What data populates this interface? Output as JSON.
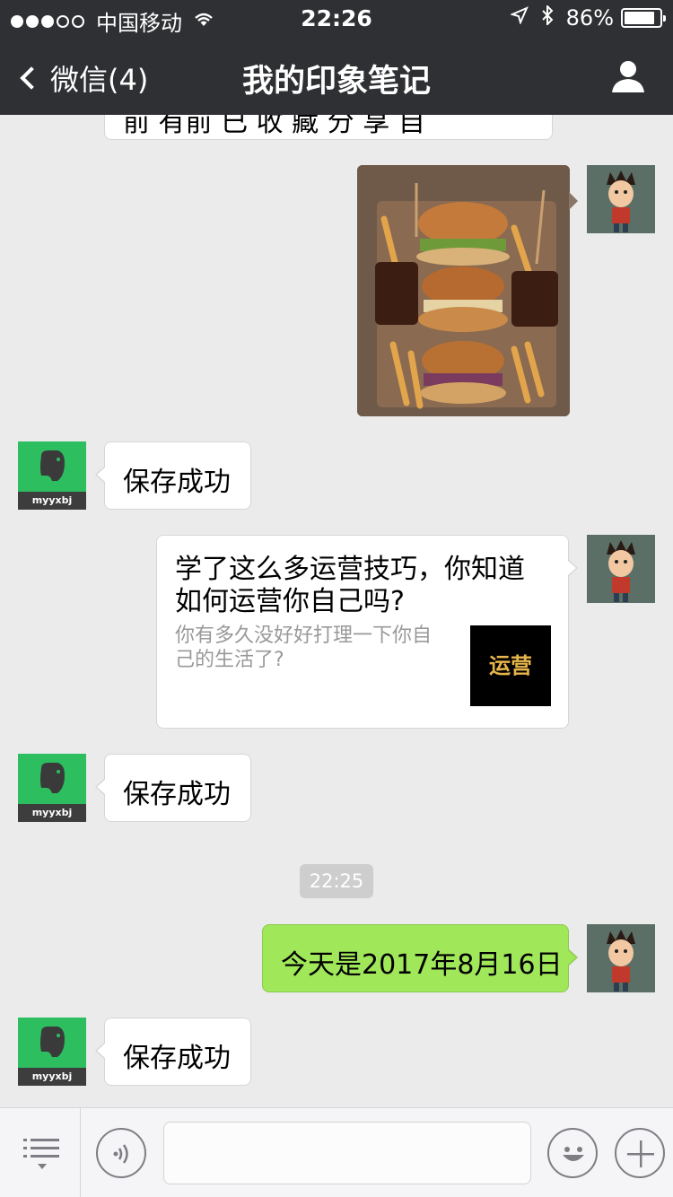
{
  "status_bar": {
    "carrier": "中国移动",
    "time": "22:26",
    "battery_percent": "86%",
    "battery_level": 0.86,
    "signal_bars_filled": 3,
    "signal_bars_total": 5
  },
  "nav": {
    "back_label": "微信(4)",
    "title": "我的印象笔记"
  },
  "messages": {
    "top_cut_text": "前 有前 已 收 藏 分 享 自",
    "saved_1": "保存成功",
    "card_title": "学了这么多运营技巧，你知道如何运营你自己吗?",
    "card_desc": "你有多久没好好打理一下你自己的生活了?",
    "card_thumb_text": "运营",
    "saved_2": "保存成功",
    "timestamp": "22:25",
    "date_message": "今天是2017年8月16日",
    "saved_3": "保存成功"
  },
  "bot": {
    "avatar_label": "myyxbj"
  },
  "colors": {
    "nav_bg": "#2f3033",
    "chat_bg": "#ebebeb",
    "outgoing_bubble": "#a0e75a",
    "evernote_green": "#2dbe60"
  },
  "icons": {
    "back": "chevron-left-icon",
    "profile": "person-icon",
    "menu": "list-menu-icon",
    "voice": "voice-icon",
    "emoji": "emoji-icon",
    "plus": "plus-icon"
  }
}
